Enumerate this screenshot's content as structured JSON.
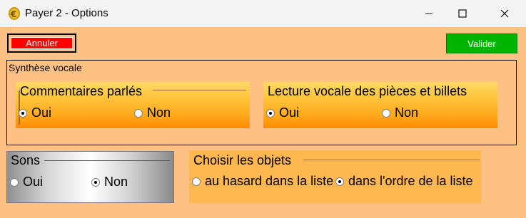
{
  "window": {
    "title": "Payer 2 - Options"
  },
  "buttons": {
    "annuler": "Annuler",
    "valider": "Valider"
  },
  "synthese": {
    "label": "Synthèse vocale"
  },
  "commentaires": {
    "title": "Commentaires parlés",
    "oui": "Oui",
    "non": "Non",
    "selected": "Oui"
  },
  "lecture": {
    "title": "Lecture vocale des pièces et billets",
    "oui": "Oui",
    "non": "Non",
    "selected": "Oui"
  },
  "sons": {
    "title": "Sons",
    "oui": "Oui",
    "non": "Non",
    "selected": "Non"
  },
  "objets": {
    "title": "Choisir les objets",
    "hasard": "au hasard dans la liste",
    "ordre": "dans l'ordre de la liste",
    "selected": "dans l'ordre de la liste"
  },
  "icons": {
    "app": "euro-coin-icon",
    "minimize": "minimize-icon",
    "maximize": "maximize-icon",
    "close": "close-icon"
  },
  "colors": {
    "background": "#fec184",
    "annuler": "#ff0000",
    "valider": "#00b400"
  }
}
